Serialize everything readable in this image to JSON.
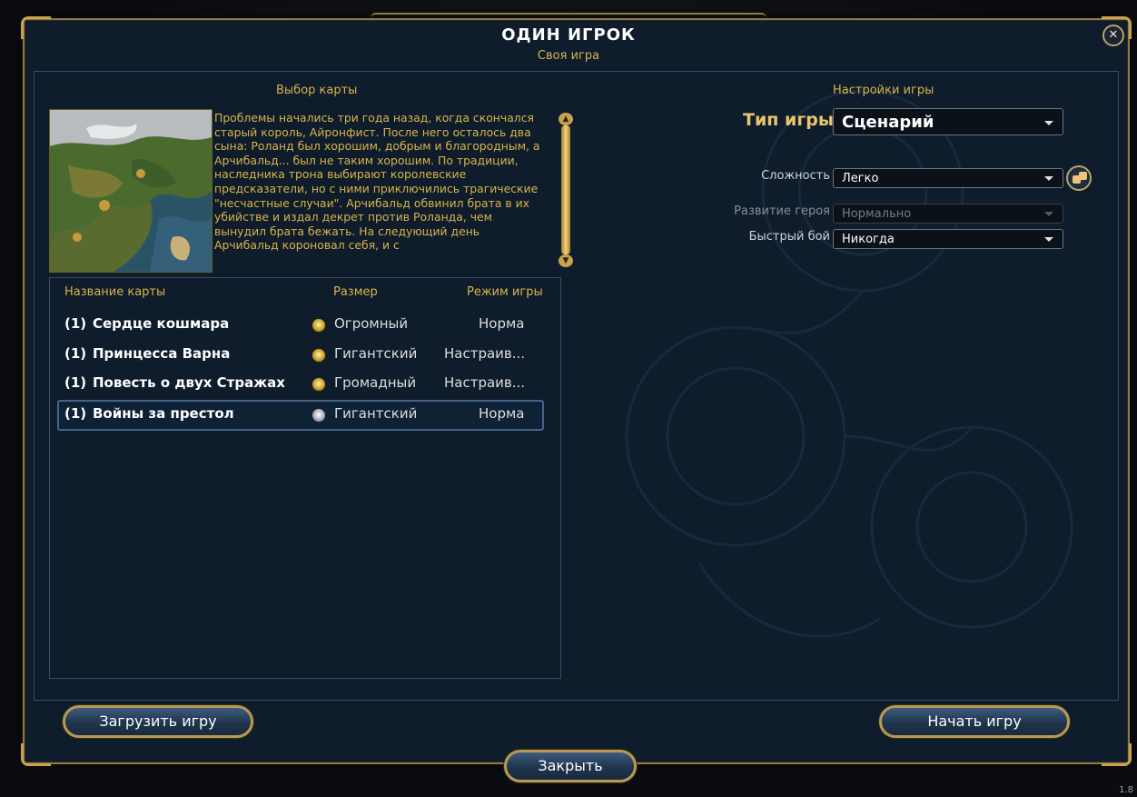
{
  "window": {
    "title": "ОДИН ИГРОК",
    "subtitle": "Своя игра"
  },
  "map_selection": {
    "header": "Выбор карты",
    "description": "Проблемы начались три года назад, когда скончался старый король, Айронфист. После него осталось два сына: Роланд был хорошим, добрым и благородным, а Арчибальд... был не таким хорошим. По традиции, наследника трона выбирают королевские предсказатели, но с ними приключились трагические \"несчастные случаи\". Арчибальд обвинил брата в их убийстве и издал декрет против Роланда, чем вынудил брата бежать. На следующий день Арчибальд короновал себя, и с",
    "columns": {
      "name": "Название карты",
      "size": "Размер",
      "mode": "Режим игры"
    },
    "maps": [
      {
        "players": "(1)",
        "name": "Сердце кошмара",
        "size": "Огромный",
        "mode": "Норма",
        "size_icon": "gold-orb-icon"
      },
      {
        "players": "(1)",
        "name": "Принцесса Варна",
        "size": "Гигантский",
        "mode": "Настраив...",
        "size_icon": "gold-orb-icon"
      },
      {
        "players": "(1)",
        "name": "Повесть о двух Стражах",
        "size": "Громадный",
        "mode": "Настраив...",
        "size_icon": "gold-orb-icon"
      },
      {
        "players": "(1)",
        "name": "Войны за престол",
        "size": "Гигантский",
        "mode": "Норма",
        "size_icon": "silver-orb-icon"
      }
    ],
    "selected_index": 3
  },
  "game_settings": {
    "header": "Настройки игры",
    "game_type_label": "Тип игры:",
    "game_type_value": "Сценарий",
    "difficulty_label": "Сложность",
    "difficulty_value": "Легко",
    "hero_dev_label": "Развитие героя",
    "hero_dev_value": "Нормально",
    "quick_combat_label": "Быстрый бой",
    "quick_combat_value": "Никогда"
  },
  "buttons": {
    "load": "Загрузить игру",
    "start": "Начать игру",
    "close": "Закрыть",
    "close_x": "✕"
  },
  "version": "1.8",
  "colors": {
    "gold_text": "#d9b44a",
    "panel_bg": "#0e1c2c",
    "frame_gold": "#b59a55"
  }
}
